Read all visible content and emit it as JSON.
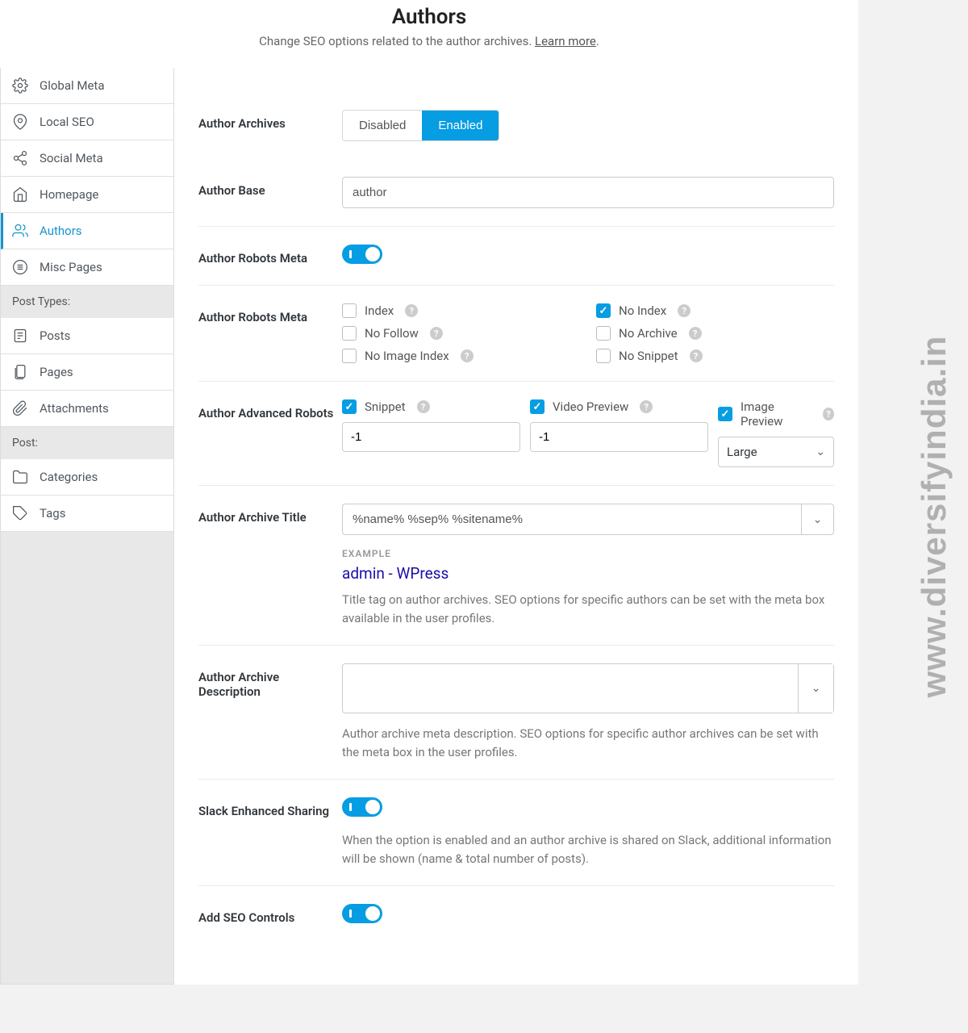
{
  "header": {
    "title": "Authors",
    "subtitle": "Change SEO options related to the author archives. ",
    "learn_more": "Learn more"
  },
  "sidebar": {
    "global_meta": "Global Meta",
    "local_seo": "Local SEO",
    "social_meta": "Social Meta",
    "homepage": "Homepage",
    "authors": "Authors",
    "misc_pages": "Misc Pages",
    "post_types_header": "Post Types:",
    "posts": "Posts",
    "pages": "Pages",
    "attachments": "Attachments",
    "post_header": "Post:",
    "categories": "Categories",
    "tags": "Tags"
  },
  "fields": {
    "author_archives": {
      "label": "Author Archives",
      "disabled": "Disabled",
      "enabled": "Enabled"
    },
    "author_base": {
      "label": "Author Base",
      "value": "author"
    },
    "robots_toggle": {
      "label": "Author Robots Meta"
    },
    "robots_meta": {
      "label": "Author Robots Meta",
      "index": "Index",
      "no_index": "No Index",
      "no_follow": "No Follow",
      "no_archive": "No Archive",
      "no_image_index": "No Image Index",
      "no_snippet": "No Snippet"
    },
    "adv_robots": {
      "label": "Author Advanced Robots",
      "snippet": "Snippet",
      "snippet_val": "-1",
      "video": "Video Preview",
      "video_val": "-1",
      "image": "Image Preview",
      "image_val": "Large"
    },
    "archive_title": {
      "label": "Author Archive Title",
      "value": "%name% %sep% %sitename%",
      "example_label": "EXAMPLE",
      "example_value": "admin - WPress",
      "help": "Title tag on author archives. SEO options for specific authors can be set with the meta box available in the user profiles."
    },
    "archive_desc": {
      "label": "Author Archive Description",
      "help": "Author archive meta description. SEO options for specific author archives can be set with the meta box in the user profiles."
    },
    "slack": {
      "label": "Slack Enhanced Sharing",
      "help": "When the option is enabled and an author archive is shared on Slack, additional information will be shown (name & total number of posts)."
    },
    "seo_controls": {
      "label": "Add SEO Controls"
    }
  },
  "watermark": "www.diversifyindia.in"
}
